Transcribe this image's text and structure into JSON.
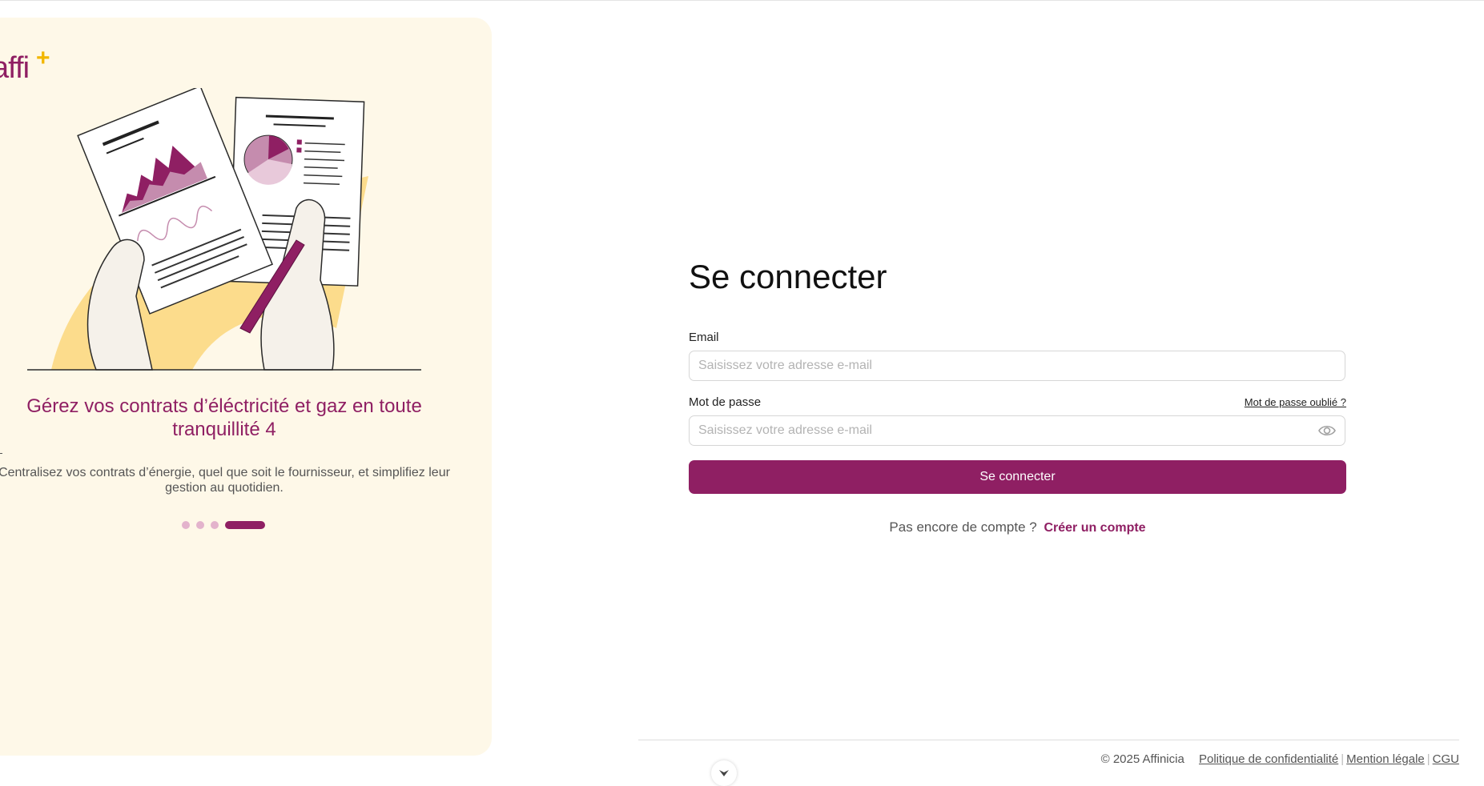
{
  "brand": {
    "logo_text": "affi",
    "logo_plus": "+",
    "primary_color": "#8f1f63",
    "accent_color": "#f2b600",
    "panel_bg": "#fef8e8"
  },
  "carousel": {
    "title": "Gérez vos contrats d’éléctricité et gaz en toute tranquillité 4",
    "description": "Centralisez vos contrats d’énergie, quel que soit le fournisseur, et simplifiez leur gestion au quotidien.",
    "dots_total": 4,
    "active_index": 4
  },
  "login": {
    "title": "Se connecter",
    "email_label": "Email",
    "email_placeholder": "Saisissez votre adresse e-mail",
    "password_label": "Mot de passe",
    "password_placeholder": "Saisissez votre adresse e-mail",
    "forgot_label": "Mot de passe oublié ?",
    "submit_label": "Se connecter",
    "signup_prompt": "Pas encore de compte ?",
    "signup_link": "Créer un compte"
  },
  "footer": {
    "copyright": "© 2025 Affinicia",
    "links": [
      "Politique de confidentialité",
      "Mention légale",
      "CGU"
    ]
  },
  "icons": {
    "eye": "eye-icon",
    "scroll": "chevron-down-icon"
  }
}
